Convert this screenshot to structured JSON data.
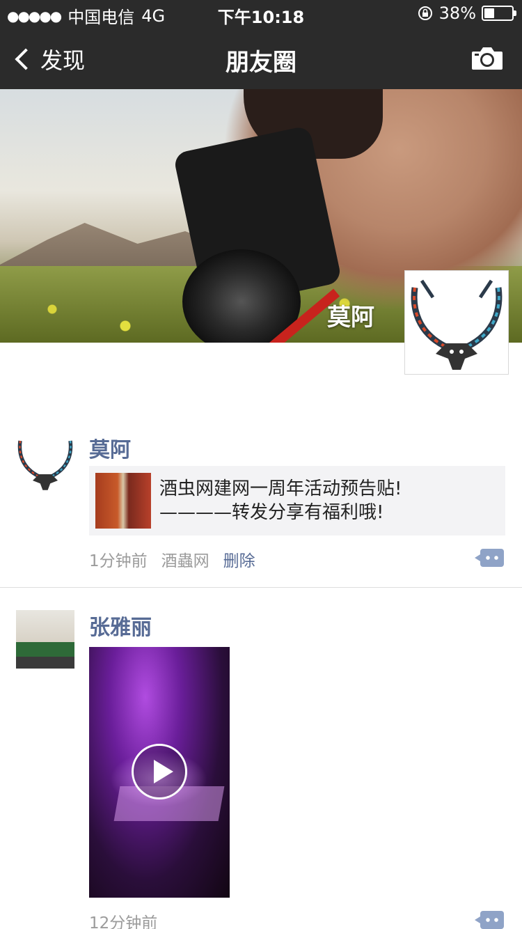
{
  "status_bar": {
    "signal": "●●●●●",
    "carrier": "中国电信",
    "network": "4G",
    "time": "下午10:18",
    "battery_percent": "38%",
    "battery_level": 0.38
  },
  "nav": {
    "back_label": "发现",
    "title": "朋友圈"
  },
  "cover": {
    "user_name": "莫阿"
  },
  "posts": [
    {
      "user": "莫阿",
      "share_text_line1": "酒虫网建网一周年活动预告贴!",
      "share_text_line2": "————转发分享有福利哦!",
      "time": "1分钟前",
      "source": "酒蟲网",
      "delete_label": "删除"
    },
    {
      "user": "张雅丽",
      "time": "12分钟前"
    }
  ],
  "colors": {
    "bar_bg": "#2b2b2b",
    "name_blue": "#576b95",
    "meta_gray": "#9b9b9b",
    "card_bg": "#f3f3f5"
  },
  "icons": [
    "back-chevron-icon",
    "camera-icon",
    "lock-rotation-icon",
    "comment-icon",
    "play-icon"
  ]
}
